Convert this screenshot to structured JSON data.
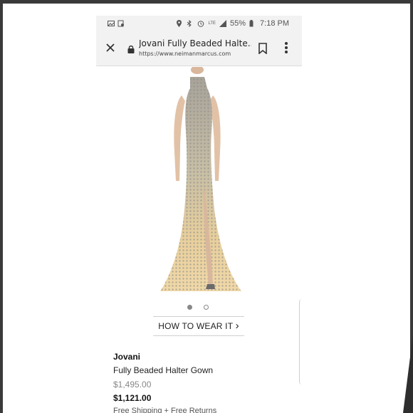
{
  "status_bar": {
    "battery": "55%",
    "time": "7:18 PM",
    "network": "LTE"
  },
  "browser": {
    "title": "Jovani Fully Beaded Halte...",
    "url": "https://www.neimanmarcus.com"
  },
  "icons": {
    "close": "close-icon",
    "lock": "lock-icon",
    "bookmark": "bookmark-icon",
    "menu": "more-vert-icon"
  },
  "carousel": {
    "count": 2,
    "active_index": 0
  },
  "how_to_wear": {
    "label": "HOW TO WEAR IT",
    "chevron": "›"
  },
  "product": {
    "brand": "Jovani",
    "name": "Fully Beaded Halter Gown",
    "original_price": "$1,495.00",
    "sale_price": "$1,121.00",
    "shipping": "Free Shipping + Free Returns"
  },
  "colors": {
    "gown": "#e8cf9c",
    "beads": "#9a9a9a",
    "frame": "#3a3a3a"
  }
}
